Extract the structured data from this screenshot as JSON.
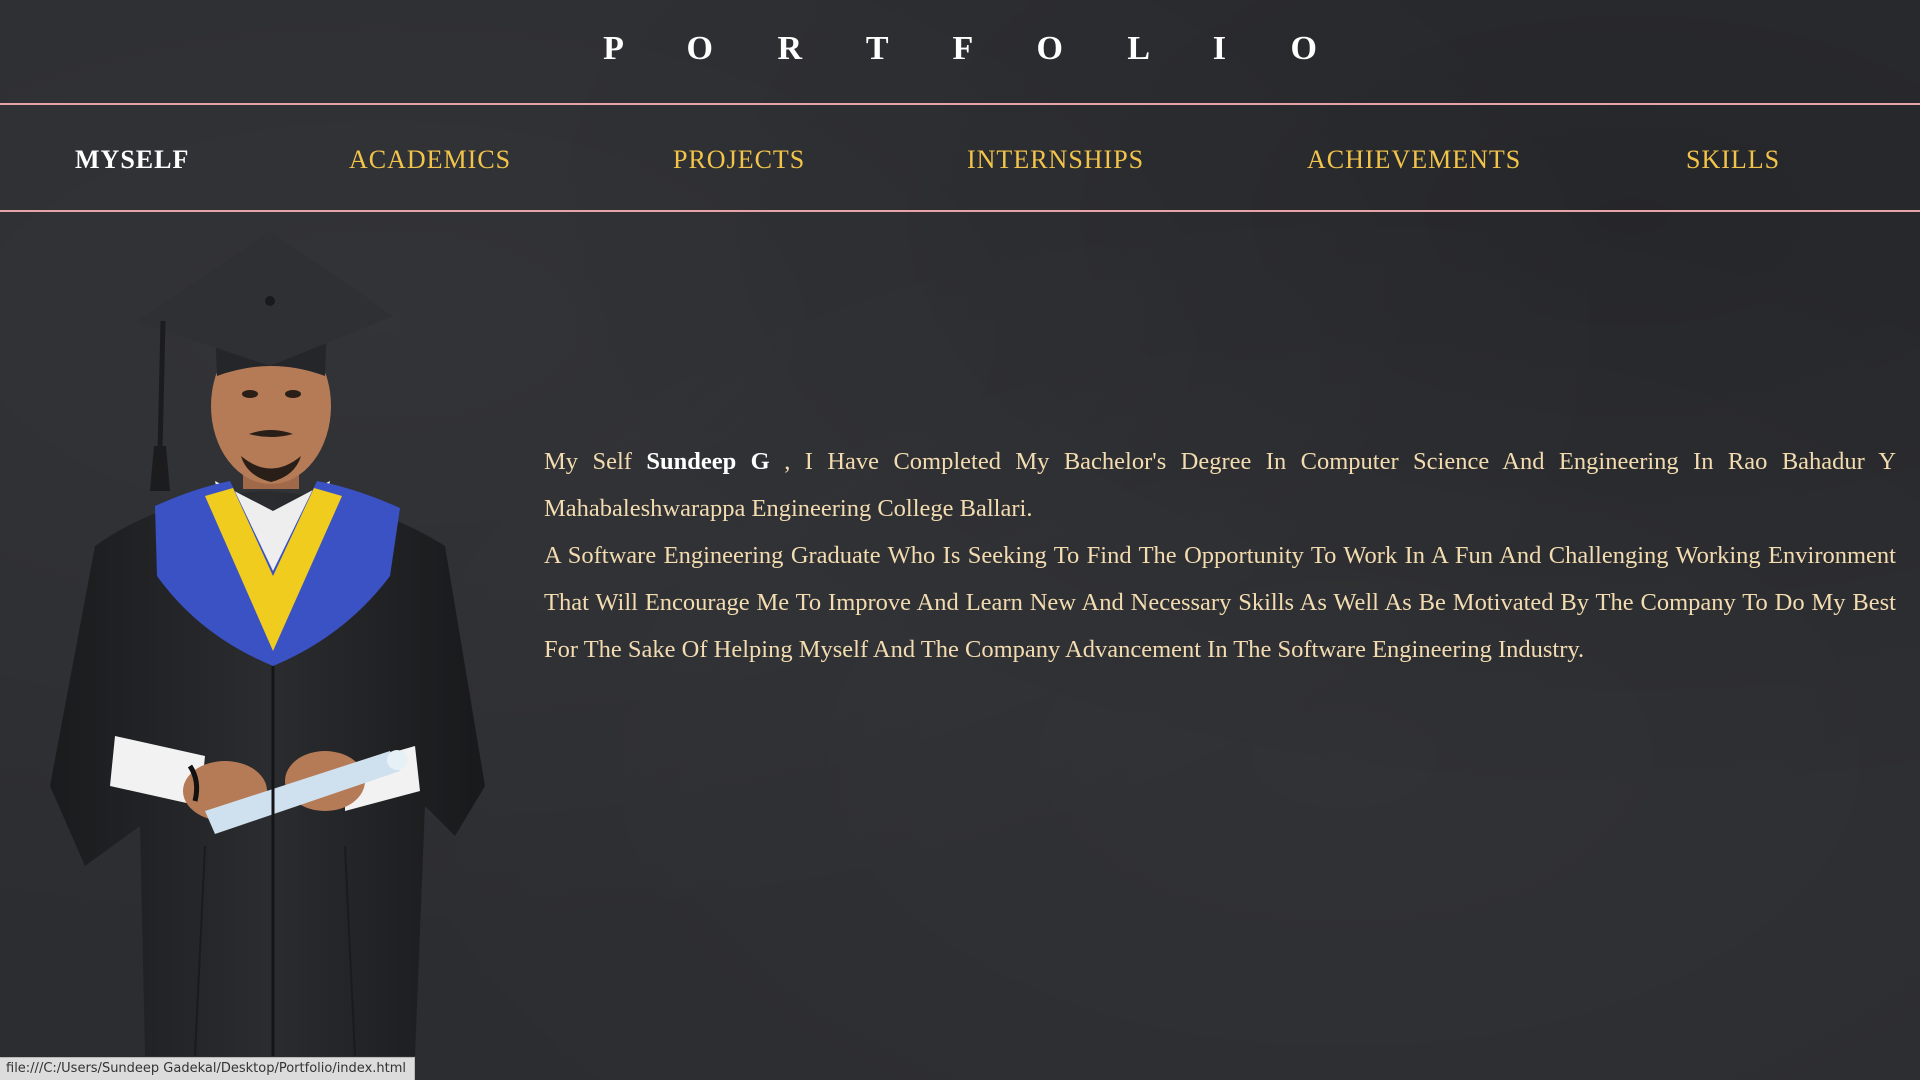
{
  "header": {
    "title": "P O R T F O L I O"
  },
  "nav": {
    "items": [
      {
        "label": "MYSELF",
        "active": true
      },
      {
        "label": "ACADEMICS",
        "active": false
      },
      {
        "label": "PROJECTS",
        "active": false
      },
      {
        "label": "INTERNSHIPS",
        "active": false
      },
      {
        "label": "ACHIEVEMENTS",
        "active": false
      },
      {
        "label": "SKILLS",
        "active": false
      }
    ]
  },
  "about": {
    "intro_prefix": "My Self",
    "name": "Sundeep G",
    "intro_suffix": ", I Have Completed My Bachelor's Degree In Computer Science And Engineering In Rao Bahadur Y Mahabaleshwarappa Engineering College Ballari.",
    "objective": "A Software Engineering Graduate Who Is Seeking To Find The Opportunity To Work In A Fun And Challenging Working Environment That Will Encourage Me To Improve And Learn New And Necessary Skills As Well As Be Motivated By The Company To Do My Best For The Sake Of Helping Myself And The Company Advancement In The Software Engineering Industry."
  },
  "status_bar": {
    "url": "file:///C:/Users/Sundeep Gadekal/Desktop/Portfolio/index.html"
  },
  "colors": {
    "background": "#2c2d31",
    "nav_text": "#f2c44a",
    "active_text": "#ffffff",
    "divider": "#e8a3a6",
    "body_text": "#f3dcb0"
  }
}
